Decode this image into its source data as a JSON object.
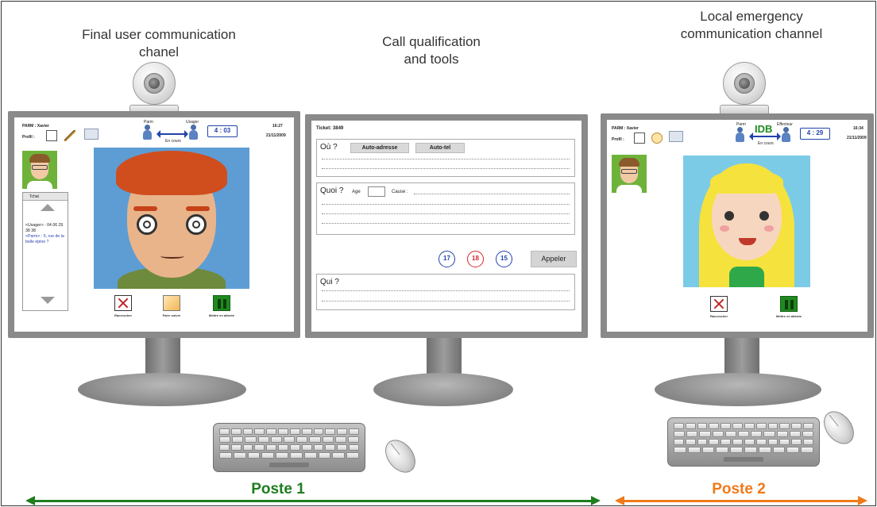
{
  "colors": {
    "poste1": "#1e7d1e",
    "poste2": "#f07a1a",
    "emergency_17": "#2244aa",
    "emergency_18": "#d6262c",
    "emergency_15": "#2244aa",
    "link_blue": "#2244aa",
    "monitor_gray": "#8a8a8a"
  },
  "captions": {
    "left": "Final user communication chanel",
    "middle": "Call qualification and tools",
    "right": "Local emergency communication channel"
  },
  "left_screen": {
    "operator": "PARM : Xavier",
    "profile": "Profil :",
    "time": "16:27",
    "date": "21/11/2009",
    "caller_label": "Parm",
    "callee_label": "Usager",
    "status": "En cours",
    "timer": "4 : 03",
    "chat_tab": "Tchat",
    "chat_user_line": "<Usager> : 04 06 29 38 38",
    "chat_parm_line": "<Parm> : 5, rue de la belle épine ?",
    "controls": [
      "Raccrocher",
      "Faire suivre",
      "Mettre en attente"
    ]
  },
  "middle_screen": {
    "ticket": "Ticket: 3849",
    "ou_label": "Où ?",
    "auto_adresse": "Auto-adresse",
    "auto_tel": "Auto-tel",
    "quoi_label": "Quoi ?",
    "age_label": "Age",
    "cause_label": "Cause :",
    "btn_17": "17",
    "btn_18": "18",
    "btn_15": "15",
    "appeler": "Appeler",
    "qui_label": "Qui ?"
  },
  "right_screen": {
    "operator": "PARM : Xavier",
    "profile": "Profil :",
    "time": "16:34",
    "date": "21/11/2009",
    "caller_label": "Parm",
    "callee_label": "Effecteur",
    "badge": "IDB",
    "status": "En cours",
    "timer": "4 : 29",
    "controls": [
      "Raccrocher",
      "Mettre en attente"
    ]
  },
  "bottom": {
    "poste1": "Poste 1",
    "poste2": "Poste 2"
  }
}
